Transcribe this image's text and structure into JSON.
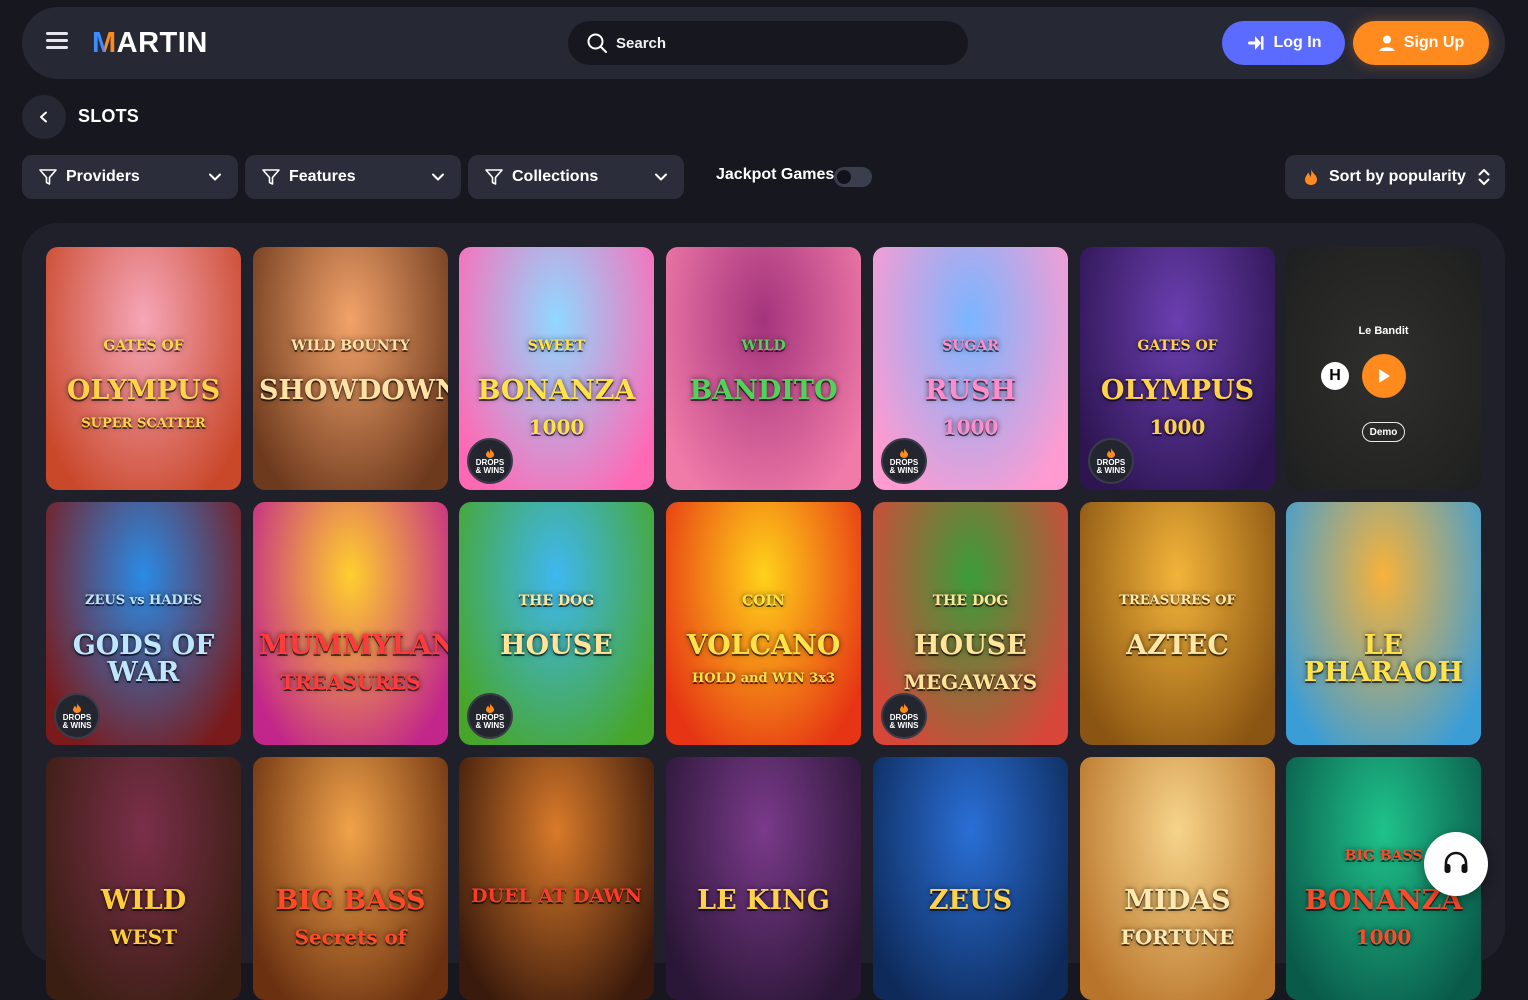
{
  "header": {
    "logo": "MARTIN",
    "search_placeholder": "Search",
    "login_label": "Log In",
    "signup_label": "Sign Up"
  },
  "page": {
    "title": "SLOTS"
  },
  "filters": {
    "providers": "Providers",
    "features": "Features",
    "collections": "Collections",
    "jackpot_label": "Jackpot Games",
    "jackpot_on": false,
    "sort_label": "Sort by popularity"
  },
  "badge": {
    "line1": "DROPS",
    "line2": "& WINS"
  },
  "games": [
    {
      "name": "GATES OF OLYMPUS SUPER SCATTER",
      "line1": "GATES OF",
      "line2": "OLYMPUS",
      "line3": "SUPER SCATTER",
      "drops": false,
      "c1": "#f6a6b8",
      "c2": "#c9482a",
      "text": "#ffd24a"
    },
    {
      "name": "WILD BOUNTY SHOWDOWN",
      "line1": "WILD BOUNTY",
      "line2": "SHOWDOWN",
      "line3": "",
      "drops": false,
      "c1": "#f2a36a",
      "c2": "#6e3a1e",
      "text": "#ffe2a6"
    },
    {
      "name": "SWEET BONANZA 1000",
      "line1": "SWEET",
      "line2": "BONANZA",
      "line3": "1000",
      "drops": true,
      "c1": "#8fd8ff",
      "c2": "#ff69b4",
      "text": "#ffe14a"
    },
    {
      "name": "WILD BANDITO",
      "line1": "WILD",
      "line2": "BANDITO",
      "line3": "",
      "drops": false,
      "c1": "#a4347c",
      "c2": "#f07aa8",
      "text": "#4fd35a"
    },
    {
      "name": "SUGAR RUSH 1000",
      "line1": "SUGAR",
      "line2": "RUSH",
      "line3": "1000",
      "drops": true,
      "c1": "#7ab5ff",
      "c2": "#ff9bd0",
      "text": "#ff8ccc"
    },
    {
      "name": "GATES OF OLYMPUS 1000",
      "line1": "GATES OF",
      "line2": "OLYMPUS",
      "line3": "1000",
      "drops": true,
      "c1": "#6b3fb0",
      "c2": "#2d1552",
      "text": "#ffd24a"
    },
    {
      "name": "Le Bandit",
      "demo": true
    },
    {
      "name": "ZEUS VS HADES GODS OF WAR",
      "line1": "ZEUS vs HADES",
      "line2": "GODS OF WAR",
      "line3": "",
      "drops": true,
      "c1": "#2a8be6",
      "c2": "#7a1a1a",
      "text": "#bfe6ff"
    },
    {
      "name": "MUMMYLAND TREASURES",
      "line1": "",
      "line2": "MUMMYLAND",
      "line3": "TREASURES",
      "drops": false,
      "c1": "#ffcf2e",
      "c2": "#c2268a",
      "text": "#ff3b3b"
    },
    {
      "name": "THE DOG HOUSE",
      "line1": "THE DOG",
      "line2": "HOUSE",
      "line3": "",
      "drops": true,
      "c1": "#3fb7f0",
      "c2": "#47a62a",
      "text": "#ffe49a"
    },
    {
      "name": "COIN VOLCANO HOLD AND WIN 3x3",
      "line1": "COIN",
      "line2": "VOLCANO",
      "line3": "HOLD and WIN 3x3",
      "drops": false,
      "c1": "#ffd21a",
      "c2": "#e63414",
      "text": "#ffe24a"
    },
    {
      "name": "THE DOG HOUSE MEGAWAYS",
      "line1": "THE DOG",
      "line2": "HOUSE",
      "line3": "MEGAWAYS",
      "drops": true,
      "c1": "#3a9d3a",
      "c2": "#d8463a",
      "text": "#ffe49a"
    },
    {
      "name": "TREASURES OF AZTEC",
      "line1": "TREASURES OF",
      "line2": "AZTEC",
      "line3": "",
      "drops": false,
      "c1": "#f2b43a",
      "c2": "#8a5412",
      "text": "#ffe7a8"
    },
    {
      "name": "LE PHARAOH",
      "line1": "",
      "line2": "LE PHARAOH",
      "line3": "",
      "drops": false,
      "c1": "#f7b23a",
      "c2": "#3b9dd6",
      "text": "#ffe14a"
    },
    {
      "name": "WILD WEST",
      "line1": "",
      "line2": "WILD",
      "line3": "WEST",
      "drops": false,
      "c1": "#7b2f4a",
      "c2": "#3a1e12",
      "text": "#ffcd3a"
    },
    {
      "name": "BIG BASS SECRETS OF",
      "line1": "",
      "line2": "BIG BASS",
      "line3": "Secrets of",
      "drops": false,
      "c1": "#f1a34a",
      "c2": "#6a3010",
      "text": "#ff4a2a"
    },
    {
      "name": "DUEL AT DAWN",
      "line1": "",
      "line2": "DUEL AT DAWN",
      "line3": "",
      "drops": false,
      "c1": "#d97a2a",
      "c2": "#3a1a0c",
      "text": "#ff3a2a"
    },
    {
      "name": "LE KING",
      "line1": "",
      "line2": "LE KING",
      "line3": "",
      "drops": false,
      "c1": "#7a3a8a",
      "c2": "#2a1636",
      "text": "#ffd24a"
    },
    {
      "name": "ZEUS",
      "line1": "",
      "line2": "ZEUS",
      "line3": "",
      "drops": false,
      "c1": "#2a6fd6",
      "c2": "#0e2a5a",
      "text": "#ffd24a"
    },
    {
      "name": "MIDAS FORTUNE",
      "line1": "",
      "line2": "MIDAS",
      "line3": "FORTUNE",
      "drops": false,
      "c1": "#f6d48a",
      "c2": "#b8742a",
      "text": "#ffe9b0"
    },
    {
      "name": "BIG BASS BONANZA 1000",
      "line1": "BIG BASS",
      "line2": "BONANZA",
      "line3": "1000",
      "drops": false,
      "c1": "#1fc28a",
      "c2": "#0a5a4a",
      "text": "#ff4a2a"
    }
  ],
  "demo": {
    "title": "Le Bandit",
    "provider_letter": "H",
    "demo_label": "Demo"
  },
  "colors": {
    "login": "#5b6bff",
    "signup": "#ff8a1e",
    "panel": "#1f2029",
    "header": "#262834"
  }
}
